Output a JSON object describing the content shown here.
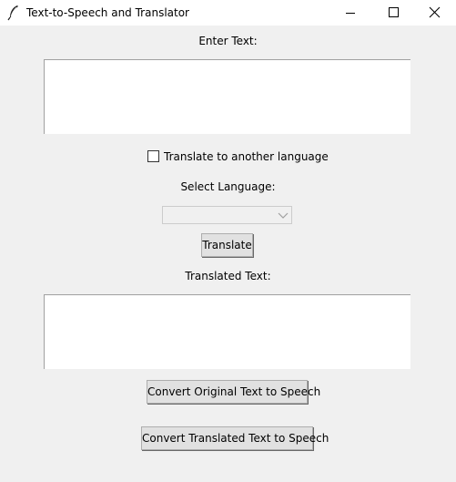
{
  "window": {
    "title": "Text-to-Speech and Translator",
    "controls": {
      "minimize_icon": "minimize-icon",
      "maximize_icon": "maximize-icon",
      "close_icon": "close-icon"
    }
  },
  "input_section": {
    "label": "Enter Text:",
    "value": ""
  },
  "translate_option": {
    "label": "Translate to another language",
    "checked": false
  },
  "language_section": {
    "label": "Select Language:",
    "selected": ""
  },
  "translate_button": {
    "label": "Translate"
  },
  "output_section": {
    "label": "Translated Text:",
    "value": ""
  },
  "speech_buttons": {
    "original_label": "Convert Original Text to Speech",
    "translated_label": "Convert Translated Text to Speech"
  },
  "colors": {
    "background": "#f0f0f0",
    "titlebar": "#ffffff",
    "button_face": "#e1e1e1",
    "button_border": "#adadad"
  }
}
